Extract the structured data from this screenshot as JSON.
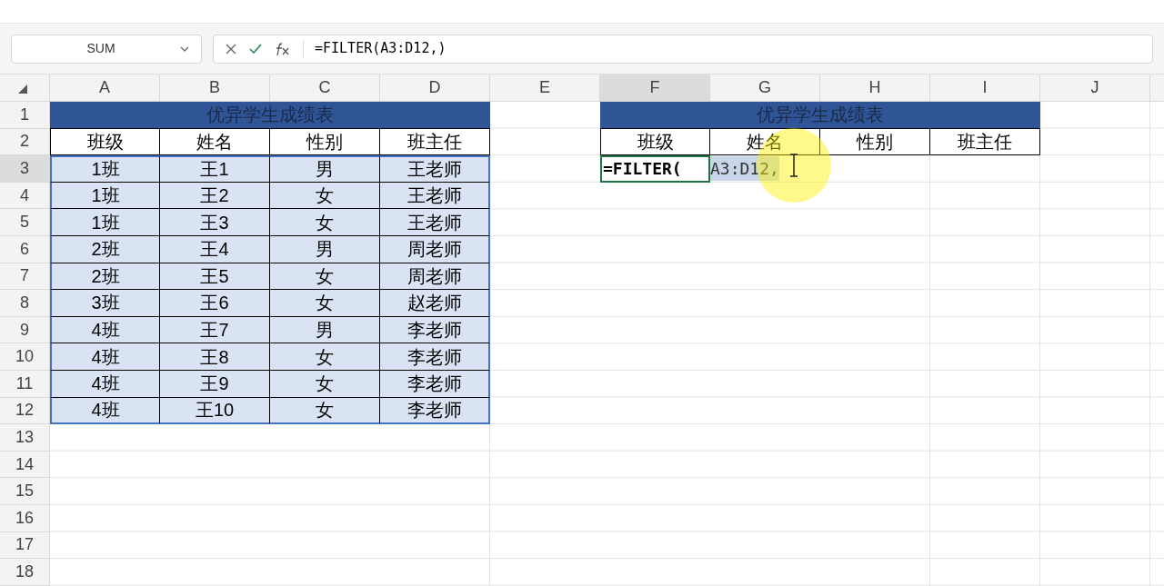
{
  "name_box": {
    "value": "SUM"
  },
  "formula_bar": {
    "value": "=FILTER(A3:D12,)"
  },
  "columns": [
    {
      "label": "A",
      "selected": false
    },
    {
      "label": "B",
      "selected": false
    },
    {
      "label": "C",
      "selected": false
    },
    {
      "label": "D",
      "selected": false
    },
    {
      "label": "E",
      "selected": false
    },
    {
      "label": "F",
      "selected": true
    },
    {
      "label": "G",
      "selected": false
    },
    {
      "label": "H",
      "selected": false
    },
    {
      "label": "I",
      "selected": false
    },
    {
      "label": "J",
      "selected": false
    }
  ],
  "rows": [
    {
      "label": "1",
      "selected": false
    },
    {
      "label": "2",
      "selected": false
    },
    {
      "label": "3",
      "selected": true
    },
    {
      "label": "4",
      "selected": false
    },
    {
      "label": "5",
      "selected": false
    },
    {
      "label": "6",
      "selected": false
    },
    {
      "label": "7",
      "selected": false
    },
    {
      "label": "8",
      "selected": false
    },
    {
      "label": "9",
      "selected": false
    },
    {
      "label": "10",
      "selected": false
    },
    {
      "label": "11",
      "selected": false
    },
    {
      "label": "12",
      "selected": false
    },
    {
      "label": "13",
      "selected": false
    },
    {
      "label": "14",
      "selected": false
    },
    {
      "label": "15",
      "selected": false
    },
    {
      "label": "16",
      "selected": false
    },
    {
      "label": "17",
      "selected": false
    },
    {
      "label": "18",
      "selected": false
    }
  ],
  "source_table": {
    "title": "优异学生成绩表",
    "headers": [
      "班级",
      "姓名",
      "性别",
      "班主任"
    ],
    "highlighted": true,
    "rows": [
      [
        "1班",
        "王1",
        "男",
        "王老师"
      ],
      [
        "1班",
        "王2",
        "女",
        "王老师"
      ],
      [
        "1班",
        "王3",
        "女",
        "王老师"
      ],
      [
        "2班",
        "王4",
        "男",
        "周老师"
      ],
      [
        "2班",
        "王5",
        "女",
        "周老师"
      ],
      [
        "3班",
        "王6",
        "女",
        "赵老师"
      ],
      [
        "4班",
        "王7",
        "男",
        "李老师"
      ],
      [
        "4班",
        "王8",
        "女",
        "李老师"
      ],
      [
        "4班",
        "王9",
        "女",
        "李老师"
      ],
      [
        "4班",
        "王10",
        "女",
        "李老师"
      ]
    ]
  },
  "target_table": {
    "title": "优异学生成绩表",
    "headers": [
      "班级",
      "姓名",
      "性别",
      "班主任"
    ]
  },
  "active_cell": {
    "function": "=FILTER(",
    "reference": "A3:D12,"
  }
}
